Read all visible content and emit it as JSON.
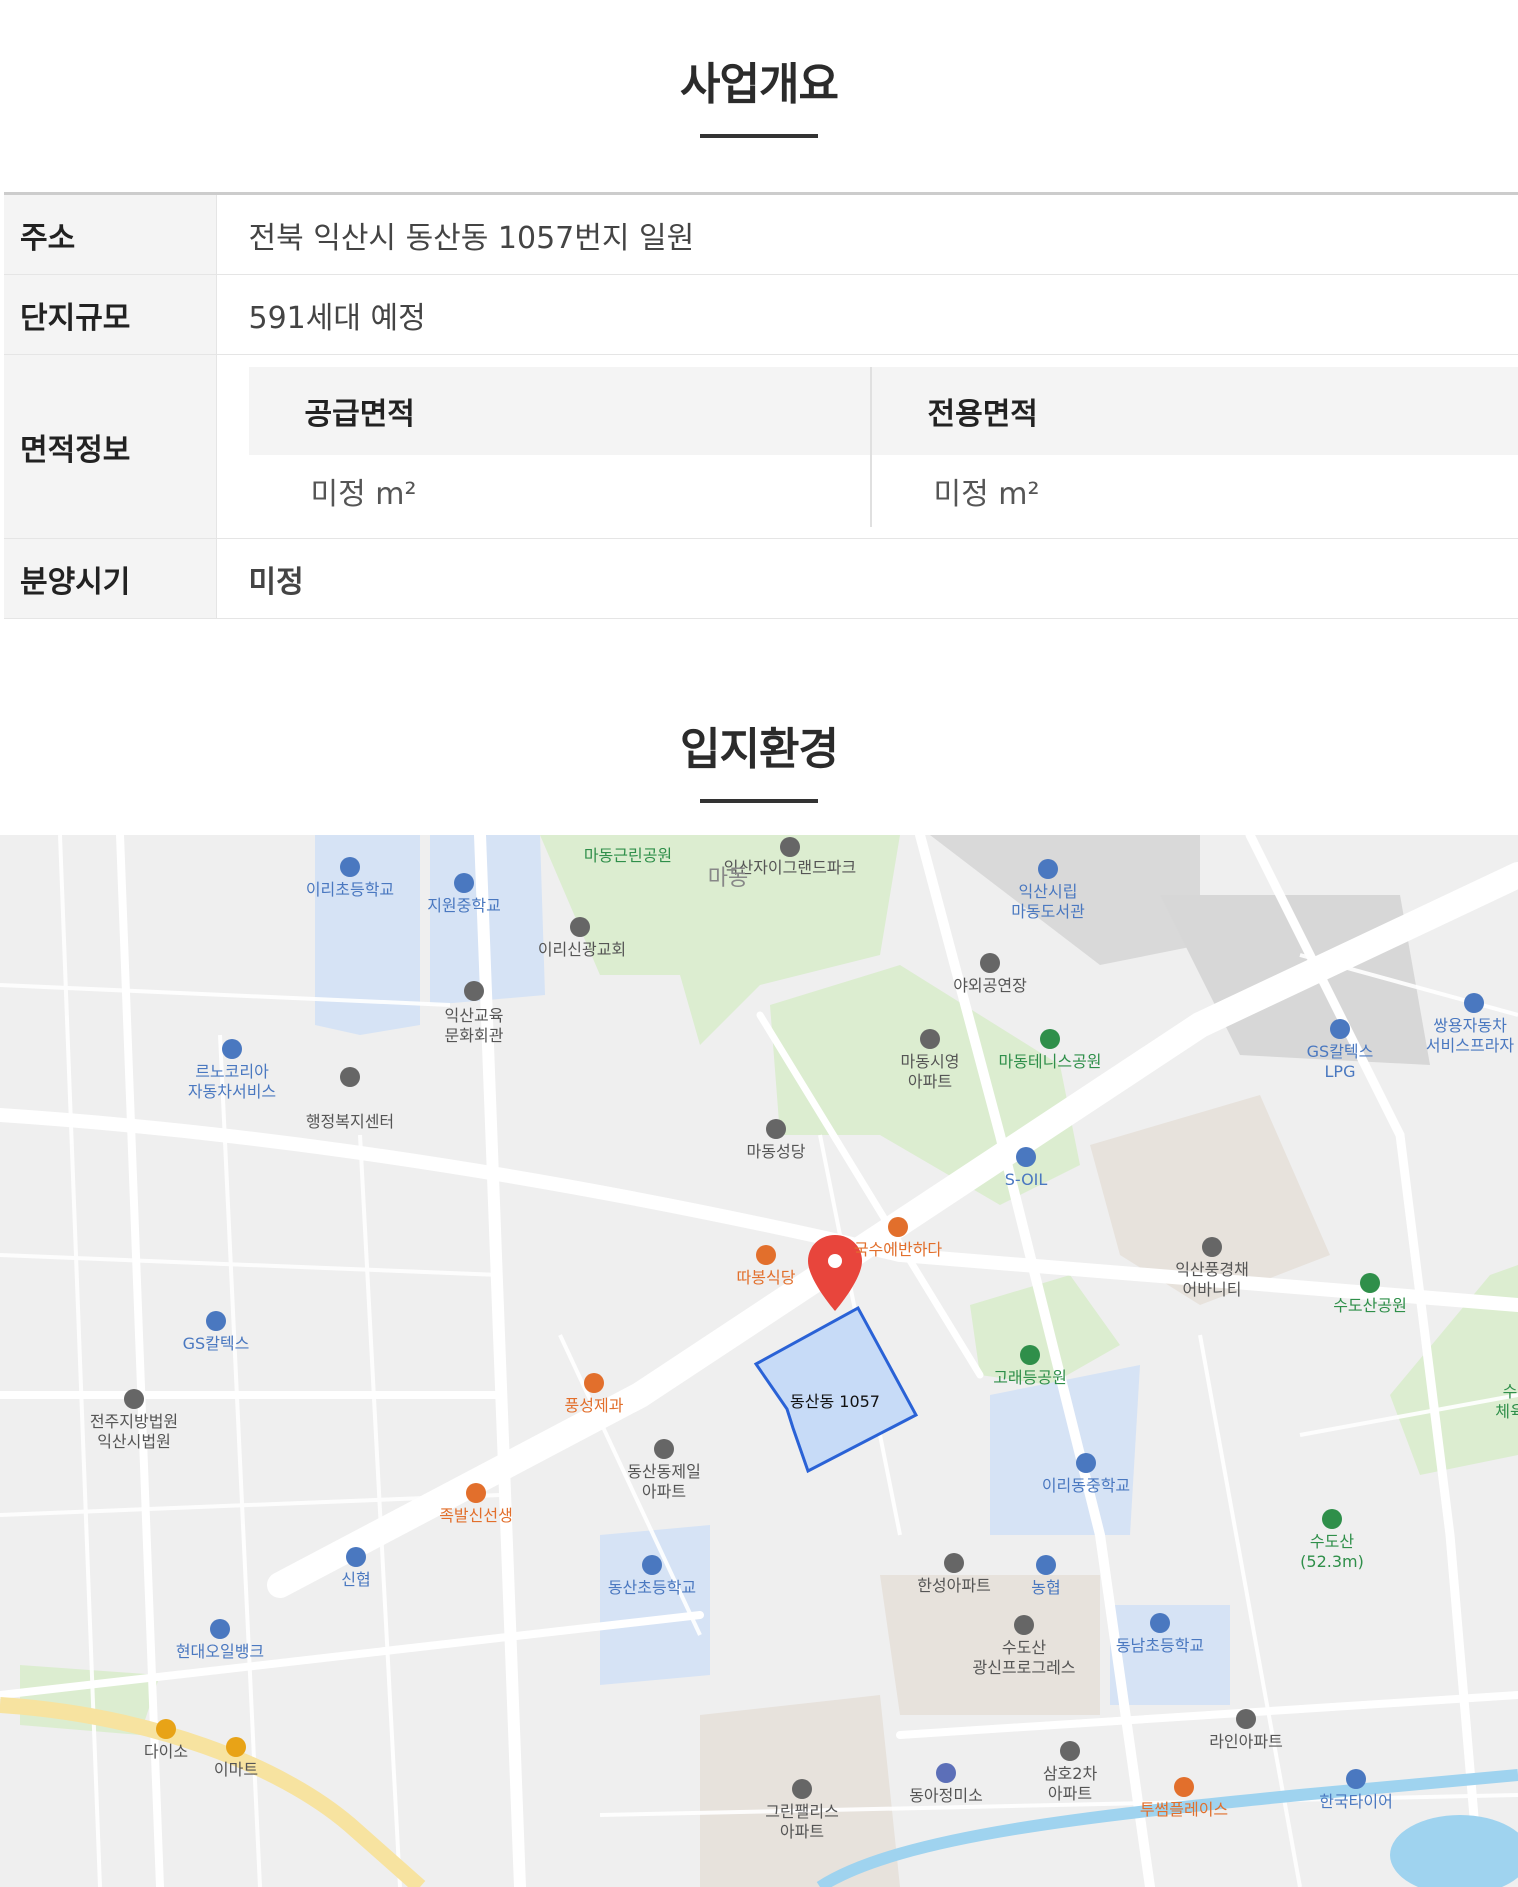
{
  "overview": {
    "title": "사업개요",
    "rows": [
      {
        "label": "주소",
        "value": "전북 익산시 동산동 1057번지 일원"
      },
      {
        "label": "단지규모",
        "value": "591세대 예정"
      },
      {
        "label": "면적정보"
      },
      {
        "label": "분양시기",
        "value": "미정"
      }
    ],
    "area": {
      "supply_label": "공급면적",
      "exclusive_label": "전용면적",
      "supply_value": "미정 m²",
      "exclusive_value": "미정 m²"
    }
  },
  "location": {
    "title": "입지환경",
    "map": {
      "marker_label": "동산동 1057",
      "places": [
        "마동근린공원",
        "익산자이그랜드파크",
        "마동",
        "익산시립",
        "마동도서관",
        "이리초등학교",
        "지원중학교",
        "이리신광교회",
        "익산교육",
        "문화회관",
        "야외공연장",
        "마동시영",
        "아파트",
        "마동테니스공원",
        "르노코리아",
        "자동차서비스",
        "행정복지센터",
        "쌍용자동차",
        "서비스프라자",
        "GS칼텍스",
        "LPG",
        "마동성당",
        "S-OIL",
        "국수에반하다",
        "따봉식당",
        "익산풍경채",
        "어바니티",
        "수도산공원",
        "GS칼텍스",
        "고래등공원",
        "풍성제과",
        "전주지방법원",
        "익산시법원",
        "동산동제일",
        "아파트",
        "이리동중학교",
        "족발신선생",
        "수도산",
        "(52.3m)",
        "신협",
        "동산초등학교",
        "한성아파트",
        "농협",
        "현대오일뱅크",
        "수도산",
        "광신프로그레스",
        "동남초등학교",
        "라인아파트",
        "다이소",
        "이마트",
        "삼호2차",
        "아파트",
        "그린팰리스",
        "아파트",
        "동아정미소",
        "투썸플레이스",
        "한국타이어",
        "수",
        "체육"
      ]
    }
  },
  "colors": {
    "accent": "#e8453c",
    "marker_area": "#c7dbf7",
    "marker_border": "#2a62d6"
  }
}
